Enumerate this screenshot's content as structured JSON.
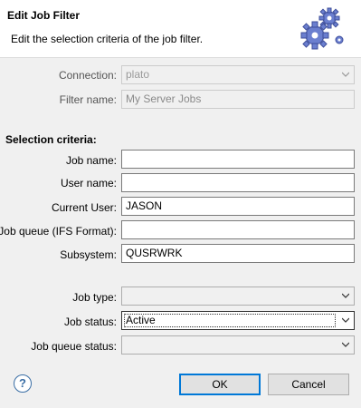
{
  "header": {
    "title": "Edit Job Filter",
    "description": "Edit the selection criteria of the job filter.",
    "icon": "gears-icon"
  },
  "connection": {
    "label": "Connection:",
    "value": "plato"
  },
  "filter_name": {
    "label": "Filter name:",
    "value": "My Server Jobs"
  },
  "selection_criteria": {
    "title": "Selection criteria:",
    "job_name": {
      "label": "Job name:",
      "value": ""
    },
    "user_name": {
      "label": "User name:",
      "value": ""
    },
    "current_user": {
      "label": "Current User:",
      "value": "JASON"
    },
    "job_queue": {
      "label": "Job queue (IFS Format):",
      "value": ""
    },
    "subsystem": {
      "label": "Subsystem:",
      "value": "QUSRWRK"
    },
    "job_type": {
      "label": "Job type:",
      "value": ""
    },
    "job_status": {
      "label": "Job status:",
      "value": "Active"
    },
    "job_queue_status": {
      "label": "Job queue status:",
      "value": ""
    }
  },
  "buttons": {
    "ok": "OK",
    "cancel": "Cancel",
    "help": "?"
  },
  "colors": {
    "default_button_border": "#0078d7",
    "help_icon": "#3a6ea5"
  }
}
